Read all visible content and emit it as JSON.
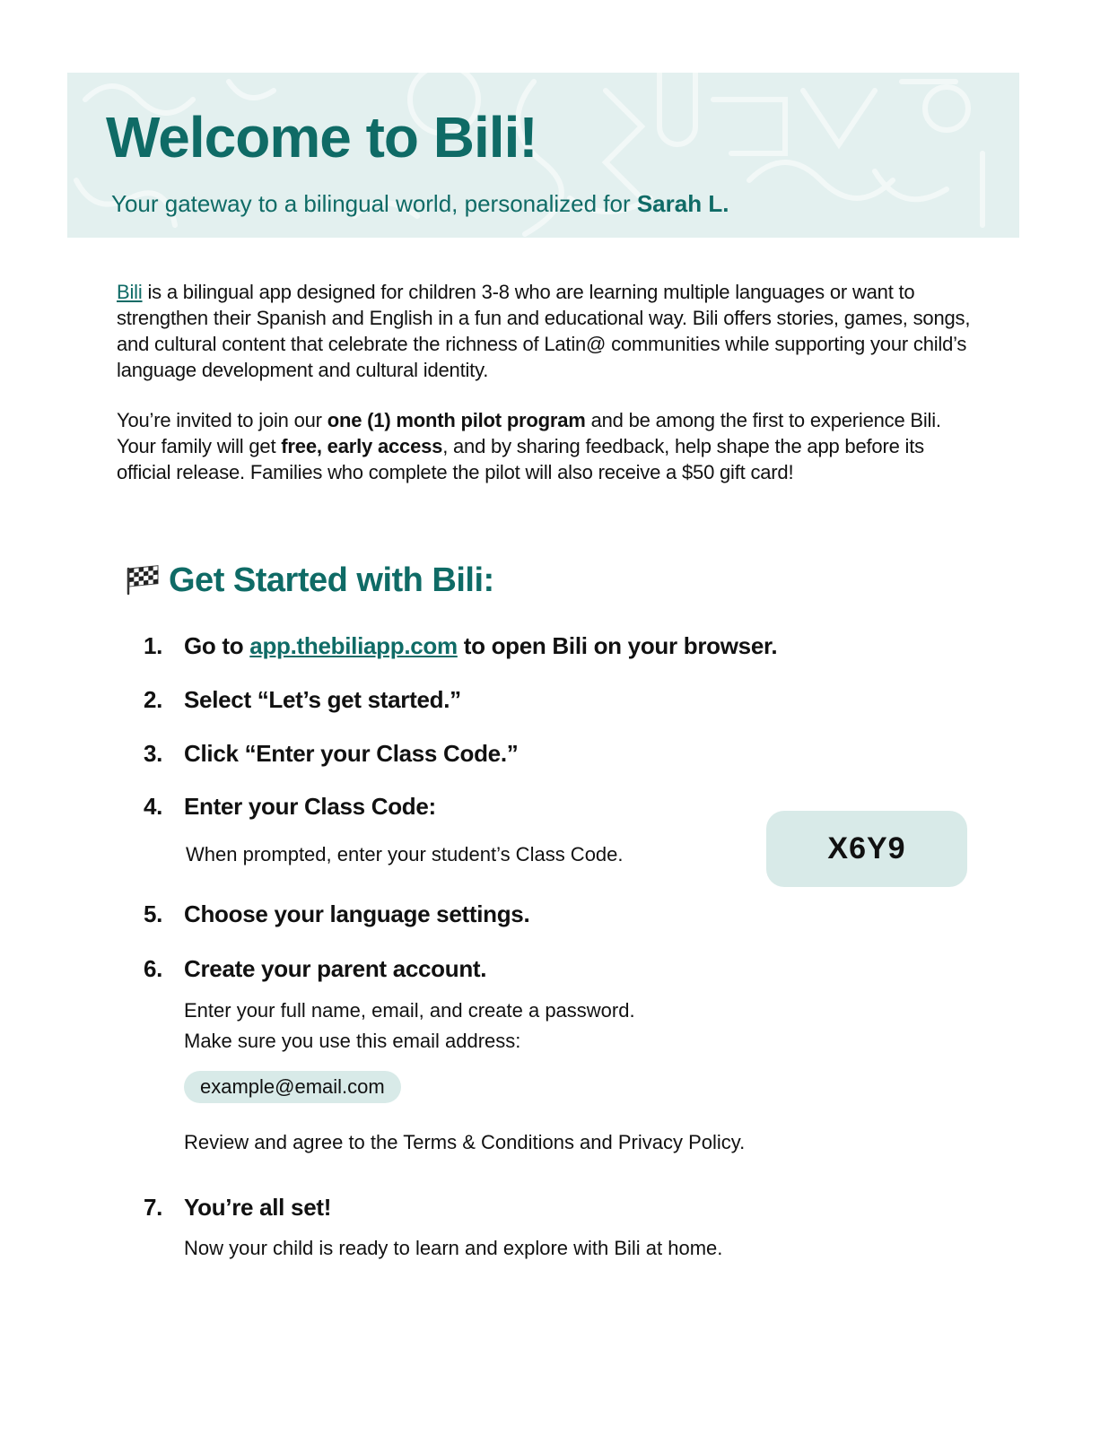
{
  "header": {
    "title": "Welcome to Bili!",
    "subtitle_prefix": "Your gateway to a bilingual world, personalized for ",
    "subtitle_name": "Sarah L."
  },
  "intro": {
    "p1_link": "Bili",
    "p1_text": " is a bilingual app designed for children 3-8 who are learning multiple languages or want to strengthen their Spanish and English in a fun and educational way. Bili offers stories, games, songs, and cultural content that celebrate the richness of Latin@ communities while supporting your child’s language development and cultural identity.",
    "p2_a": "You’re invited to join our ",
    "p2_bold1": "one (1) month pilot program",
    "p2_b": " and be among the first to experience Bili. Your family will get ",
    "p2_bold2": "free, early access",
    "p2_c": ", and by sharing feedback, help shape the app before its official release. Families who complete the pilot will also receive a $50 gift card!"
  },
  "get_started": {
    "title": "Get Started with Bili:",
    "icon": "checkered-flag-icon"
  },
  "steps": {
    "s1": {
      "num": "1.",
      "pre": "Go to ",
      "link": "app.thebiliapp.com",
      "post": " to open Bili on your browser."
    },
    "s2": {
      "num": "2.",
      "label": "Select “Let’s get started.”"
    },
    "s3": {
      "num": "3.",
      "label": "Click “Enter your Class Code.”"
    },
    "s4": {
      "num": "4.",
      "label": "Enter your Class Code:",
      "detail": "When prompted, enter your student’s Class Code.",
      "code": "X6Y9"
    },
    "s5": {
      "num": "5.",
      "label": "Choose your language settings."
    },
    "s6": {
      "num": "6.",
      "label": "Create your parent account.",
      "detail1": "Enter your full name, email, and create a password.",
      "detail2": "Make sure you use this email address:",
      "email": "example@email.com",
      "detail3": "Review and agree to the Terms & Conditions and Privacy Policy."
    },
    "s7": {
      "num": "7.",
      "label": "You’re all set!",
      "detail": "Now your child is ready to learn and explore with Bili at home."
    }
  },
  "colors": {
    "brand_teal": "#0f6b66",
    "banner_bg": "#e3f0ef",
    "pill_bg": "#d8eae8"
  }
}
